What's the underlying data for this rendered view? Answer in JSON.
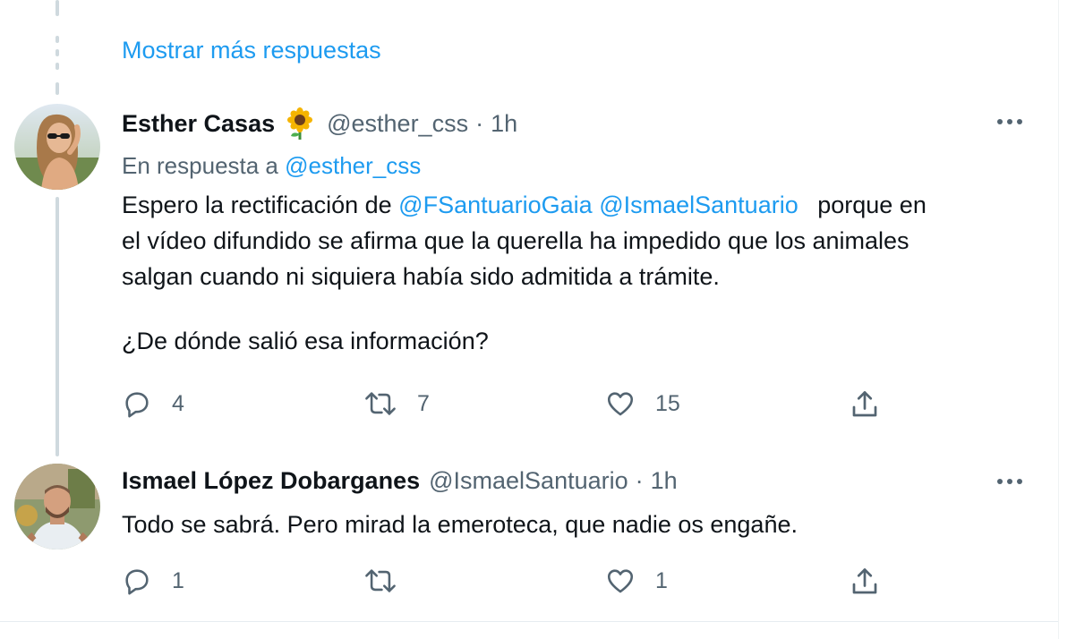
{
  "thread": {
    "show_more": "Mostrar más respuestas"
  },
  "tweets": [
    {
      "name": "Esther Casas",
      "emoji": "🌻",
      "handle": "@esther_css",
      "separator": "·",
      "time": "1h",
      "reply_prefix": "En respuesta a",
      "reply_handle": "@esther_css",
      "text_before": "Espero la rectificación de",
      "mention_1": "@FSantuarioGaia",
      "mention_2": "@IsmaelSantuario",
      "text_after": "porque en",
      "line_2": "el vídeo difundido se afirma que la querella ha impedido que los animales",
      "line_3": "salgan cuando ni siquiera había sido admitida a trámite.",
      "line_4": "¿De dónde salió esa información?",
      "replies": "4",
      "retweets": "7",
      "likes": "15"
    },
    {
      "name": "Ismael López Dobarganes",
      "handle": "@IsmaelSantuario",
      "separator": "·",
      "time": "1h",
      "text": "Todo se sabrá. Pero mirad la emeroteca, que nadie os engañe.",
      "replies": "1",
      "retweets": "",
      "likes": "1"
    }
  ],
  "icons": {
    "reply": "reply-icon",
    "retweet": "retweet-icon",
    "like": "heart-icon",
    "share": "share-icon",
    "more": "more-icon"
  },
  "colors": {
    "link": "#1d9bf0",
    "secondary": "#536471",
    "primary_text": "#0f1419",
    "thread_line": "#cfd9de"
  }
}
